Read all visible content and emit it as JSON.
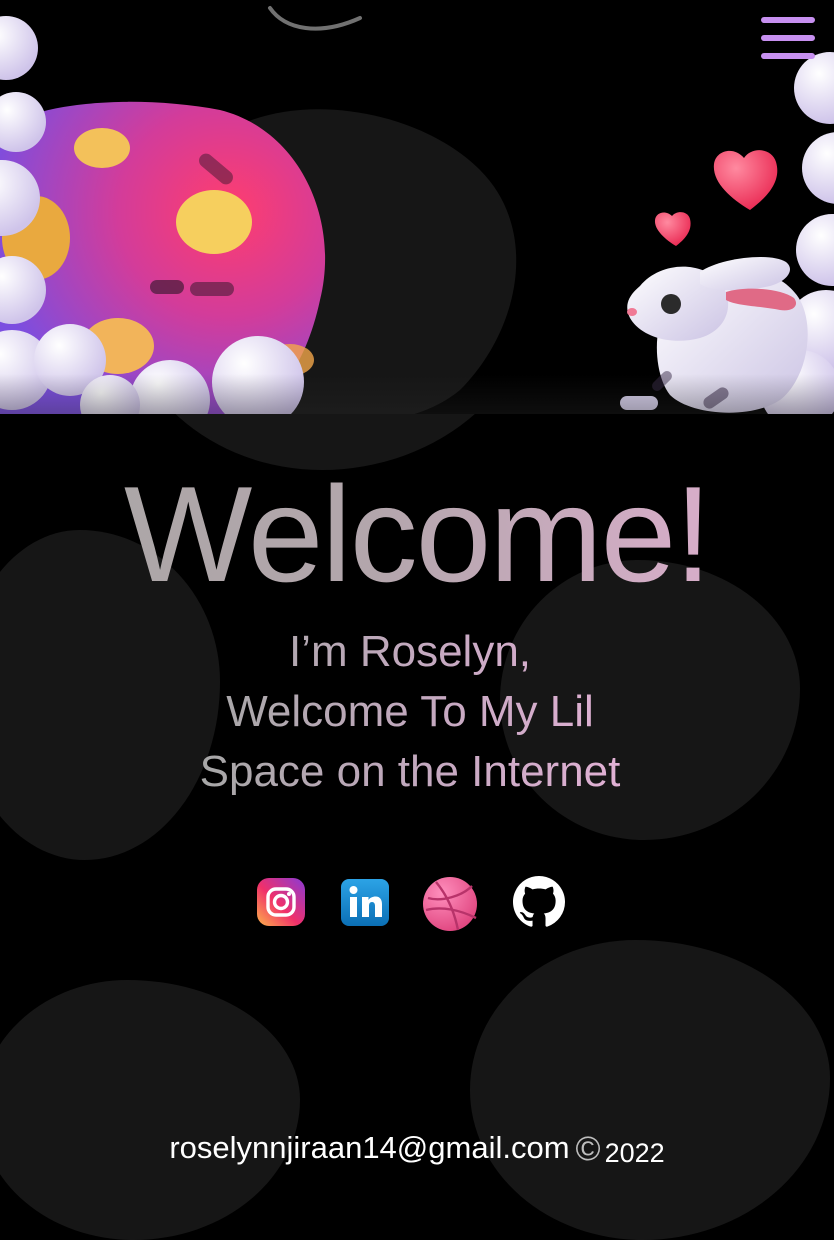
{
  "menu": {
    "icon": "hamburger-menu-icon"
  },
  "hero": {
    "planet_icon": "planet-illustration",
    "bunny_icon": "bunny-illustration",
    "hearts_icon": "hearts-illustration"
  },
  "welcome": {
    "title": "Welcome!",
    "intro_lines": [
      "I’m Roselyn,",
      "Welcome To My Lil",
      "Space on the Internet"
    ]
  },
  "socials": [
    {
      "name": "Instagram",
      "icon": "instagram-icon"
    },
    {
      "name": "LinkedIn",
      "icon": "linkedin-icon"
    },
    {
      "name": "Dribbble",
      "icon": "dribbble-icon"
    },
    {
      "name": "GitHub",
      "icon": "github-icon"
    }
  ],
  "footer": {
    "email": "roselynnjiraan14@gmail.com",
    "copyright_symbol": "©",
    "year": "2022"
  },
  "colors": {
    "background": "#000000",
    "menu": "#c790f0",
    "title_gradient_start": "#a9a7a5",
    "title_gradient_end": "#e5b0d4"
  }
}
